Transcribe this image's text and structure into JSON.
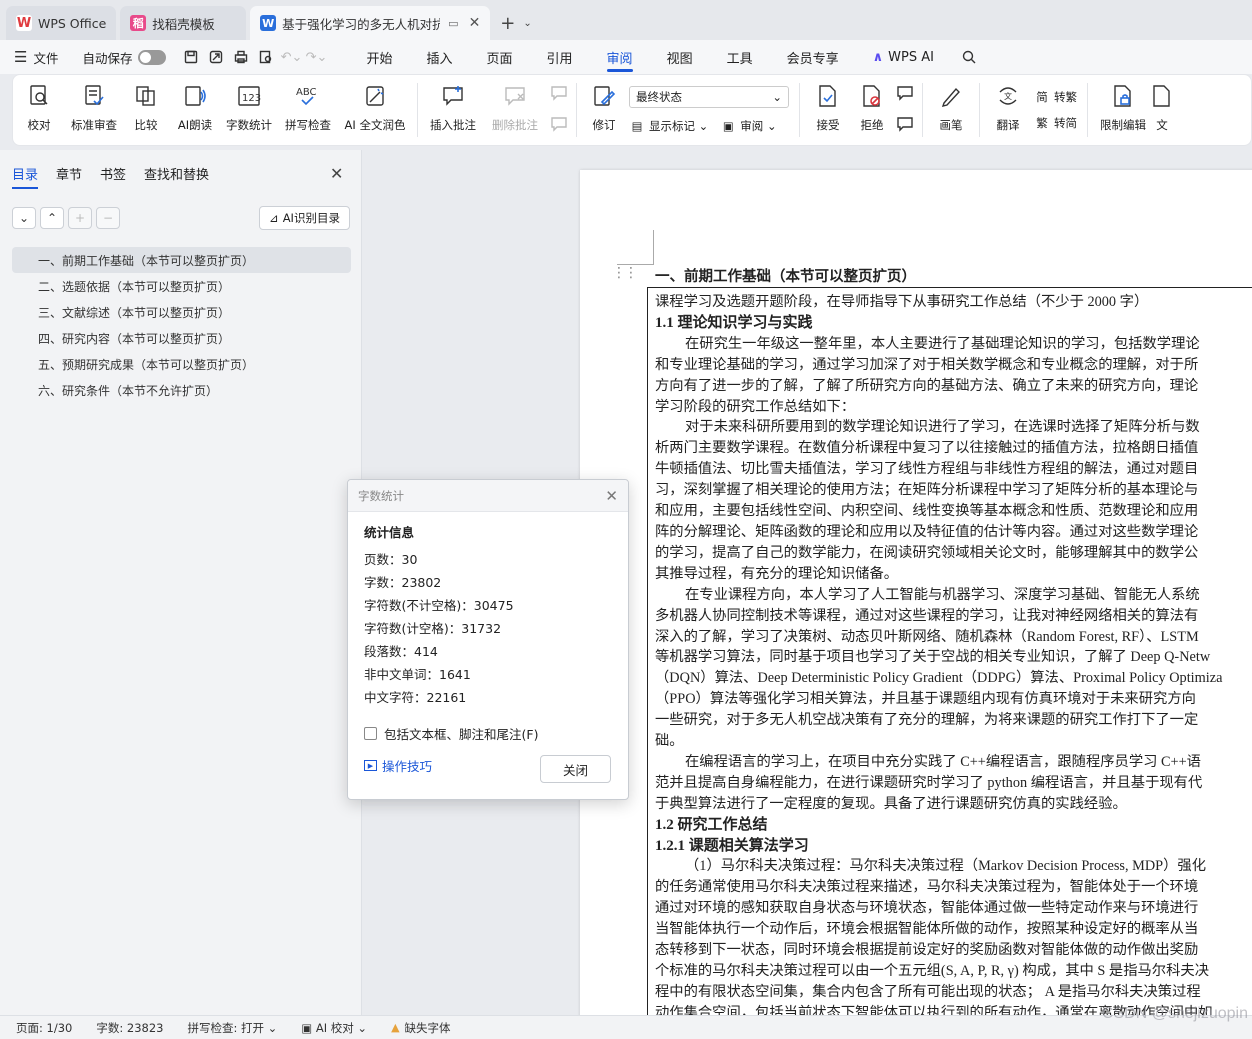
{
  "tabs": [
    {
      "label": "WPS Office",
      "icon": "wps-logo-icon"
    },
    {
      "label": "找稻壳模板",
      "icon": "docer-logo-icon"
    },
    {
      "label": "基于强化学习的多无人机对抗",
      "icon": "writer-doc-icon",
      "active": true
    }
  ],
  "menu": {
    "file": "文件",
    "autosave": "自动保存",
    "tabs": [
      "开始",
      "插入",
      "页面",
      "引用",
      "审阅",
      "视图",
      "工具",
      "会员专享"
    ],
    "active_tab": "审阅",
    "wps_ai": "WPS AI"
  },
  "ribbon": {
    "proofread": "校对",
    "standard_review": "标准审查",
    "compare": "比较",
    "ai_read": "AI朗读",
    "word_count": "字数统计",
    "spell_check": "拼写检查",
    "ai_polish": "AI 全文润色",
    "insert_comment": "插入批注",
    "delete_comment": "删除批注",
    "revise": "修订",
    "state_select": "最终状态",
    "show_marks": "显示标记",
    "review_pane": "审阅",
    "accept": "接受",
    "reject": "拒绝",
    "pen": "画笔",
    "translate": "翻译",
    "to_traditional": "转繁",
    "to_simplified": "转简",
    "restrict_edit": "限制编辑",
    "doc_partial": "文"
  },
  "nav": {
    "tabs": [
      "目录",
      "章节",
      "书签",
      "查找和替换"
    ],
    "ai_toc": "AI识别目录",
    "toc": [
      "一、前期工作基础（本节可以整页扩页）",
      "二、选题依据（本节可以整页扩页）",
      "三、文献综述（本节可以整页扩页）",
      "四、研究内容（本节可以整页扩页）",
      "五、预期研究成果（本节可以整页扩页）",
      "六、研究条件（本节不允许扩页）"
    ]
  },
  "doc": {
    "heading": "一、前期工作基础（本节可以整页扩页）",
    "lines": [
      {
        "t": "课程学习及选题开题阶段，在导师指导下从事研究工作总结（不少于 2000 字）",
        "s": ""
      },
      {
        "t": "1.1 理论知识学习与实践",
        "s": "b"
      },
      {
        "t": "在研究生一年级这一整年里，本人主要进行了基础理论知识的学习，包括数学理论",
        "s": "ind"
      },
      {
        "t": "和专业理论基础的学习，通过学习加深了对于相关数学概念和专业概念的理解，对于所",
        "s": ""
      },
      {
        "t": "方向有了进一步的了解，了解了所研究方向的基础方法、确立了未来的研究方向，理论",
        "s": ""
      },
      {
        "t": "学习阶段的研究工作总结如下：",
        "s": ""
      },
      {
        "t": "对于未来科研所要用到的数学理论知识进行了学习，在选课时选择了矩阵分析与数",
        "s": "ind"
      },
      {
        "t": "析两门主要数学课程。在数值分析课程中复习了以往接触过的插值方法，拉格朗日插值",
        "s": ""
      },
      {
        "t": "牛顿插值法、切比雪夫插值法，学习了线性方程组与非线性方程组的解法，通过对题目",
        "s": ""
      },
      {
        "t": "习，深刻掌握了相关理论的使用方法；在矩阵分析课程中学习了矩阵分析的基本理论与",
        "s": ""
      },
      {
        "t": "和应用，主要包括线性空间、内积空间、线性变换等基本概念和性质、范数理论和应用",
        "s": ""
      },
      {
        "t": "阵的分解理论、矩阵函数的理论和应用以及特征值的估计等内容。通过对这些数学理论",
        "s": ""
      },
      {
        "t": "的学习，提高了自己的数学能力，在阅读研究领域相关论文时，能够理解其中的数学公",
        "s": ""
      },
      {
        "t": "其推导过程，有充分的理论知识储备。",
        "s": ""
      },
      {
        "t": "在专业课程方向，本人学习了人工智能与机器学习、深度学习基础、智能无人系统",
        "s": "ind"
      },
      {
        "t": "多机器人协同控制技术等课程，通过对这些课程的学习，让我对神经网络相关的算法有",
        "s": ""
      },
      {
        "t": "深入的了解，学习了决策树、动态贝叶斯网络、随机森林（Random Forest, RF）、LSTM",
        "s": ""
      },
      {
        "t": "等机器学习算法，同时基于项目也学习了关于空战的相关专业知识，了解了 Deep Q-Netw",
        "s": ""
      },
      {
        "t": "（DQN）算法、Deep Deterministic Policy Gradient（DDPG）算法、Proximal Policy Optimiza",
        "s": ""
      },
      {
        "t": "（PPO）算法等强化学习相关算法，并且基于课题组内现有仿真环境对于未来研究方向",
        "s": ""
      },
      {
        "t": "一些研究，对于多无人机空战决策有了充分的理解，为将来课题的研究工作打下了一定",
        "s": ""
      },
      {
        "t": "础。",
        "s": ""
      },
      {
        "t": "在编程语言的学习上，在项目中充分实践了 C++编程语言，跟随程序员学习 C++语",
        "s": "ind"
      },
      {
        "t": "范并且提高自身编程能力，在进行课题研究时学习了 python 编程语言，并且基于现有代",
        "s": ""
      },
      {
        "t": "于典型算法进行了一定程度的复现。具备了进行课题研究仿真的实践经验。",
        "s": ""
      },
      {
        "t": "1.2 研究工作总结",
        "s": "b"
      },
      {
        "t": "1.2.1 课题相关算法学习",
        "s": "b"
      },
      {
        "t": "（1）马尔科夫决策过程：马尔科夫决策过程（Markov Decision Process, MDP）强化",
        "s": "ind"
      },
      {
        "t": "的任务通常使用马尔科夫决策过程来描述，马尔科夫决策过程为，智能体处于一个环境",
        "s": ""
      },
      {
        "t": "通过对环境的感知获取自身状态与环境状态，智能体通过做一些特定动作来与环境进行",
        "s": ""
      },
      {
        "t": "当智能体执行一个动作后，环境会根据智能体所做的动作，按照某种设定好的概率从当",
        "s": ""
      },
      {
        "t": "态转移到下一状态，同时环境会根据提前设定好的奖励函数对智能体做的动作做出奖励",
        "s": ""
      },
      {
        "t": "个标准的马尔科夫决策过程可以由一个五元组(S, A, P, R, γ) 构成，其中 S 是指马尔科夫决",
        "s": ""
      },
      {
        "t": "程中的有限状态空间集，集合内包含了所有可能出现的状态； A 是指马尔科夫决策过程",
        "s": ""
      },
      {
        "t": "动作集合空间，包括当前状态下智能体可以执行到的所有动作，通常在离散动作空间中如",
        "s": ""
      }
    ]
  },
  "dialog": {
    "title": "字数统计",
    "section": "统计信息",
    "stats": [
      {
        "label": "页数：30"
      },
      {
        "label": "字数：23802"
      },
      {
        "label": "字符数(不计空格)：30475"
      },
      {
        "label": "字符数(计空格)：31732"
      },
      {
        "label": "段落数：414"
      },
      {
        "label": "非中文单词：1641"
      },
      {
        "label": "中文字符：22161"
      }
    ],
    "checkbox": "包括文本框、脚注和尾注(F)",
    "tips": "操作技巧",
    "close": "关闭"
  },
  "status": {
    "page": "页面: 1/30",
    "words": "字数: 23823",
    "spell": "拼写检查: 打开",
    "ai_check": "AI 校对",
    "missing_font": "缺失字体"
  },
  "watermark": "CSDN @shejizuopin",
  "colors": {
    "accent": "#1a56d8",
    "wps_red": "#e03a3e",
    "ai_purple": "#5a4cf0"
  }
}
